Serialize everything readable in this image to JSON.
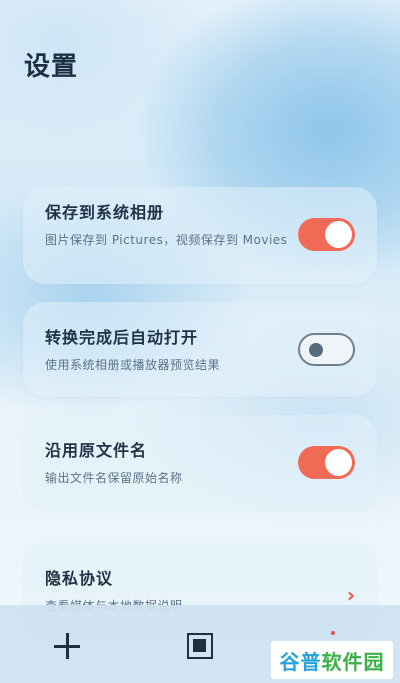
{
  "page": {
    "title": "设置"
  },
  "settings": [
    {
      "title": "保存到系统相册",
      "desc": "图片保存到 Pictures，视频保存到 Movies",
      "toggle": "on"
    },
    {
      "title": "转换完成后自动打开",
      "desc": "使用系统相册或播放器预览结果",
      "toggle": "off"
    },
    {
      "title": "沿用原文件名",
      "desc": "输出文件名保留原始名称",
      "toggle": "on"
    },
    {
      "title": "隐私协议",
      "desc": "查看媒体与本地数据说明",
      "chevron": "›"
    }
  ],
  "colors": {
    "accent": "#f16a55",
    "text": "#1f3246"
  },
  "bottom_nav": {
    "icons": [
      "plus-icon",
      "stop-square-icon",
      "dot-icon"
    ]
  },
  "watermark": {
    "part1": "谷普",
    "part2": "软件园"
  }
}
